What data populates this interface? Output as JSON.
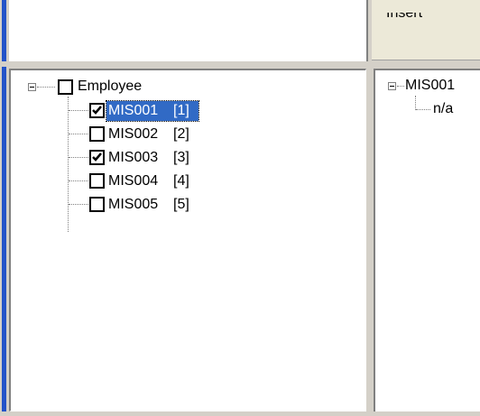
{
  "window": {
    "accent_color": "#2353c8",
    "top_panel_label": "Insert"
  },
  "left_tree": {
    "root": {
      "label": "Employee",
      "checked": false,
      "expanded": true
    },
    "items": [
      {
        "label": "MIS001",
        "index": "[1]",
        "checked": true,
        "selected": true
      },
      {
        "label": "MIS002",
        "index": "[2]",
        "checked": false,
        "selected": false
      },
      {
        "label": "MIS003",
        "index": "[3]",
        "checked": true,
        "selected": false
      },
      {
        "label": "MIS004",
        "index": "[4]",
        "checked": false,
        "selected": false
      },
      {
        "label": "MIS005",
        "index": "[5]",
        "checked": false,
        "selected": false
      }
    ],
    "selection_color": "#316ac5"
  },
  "right_tree": {
    "root_label": "MIS001",
    "child_label": "n/a"
  }
}
